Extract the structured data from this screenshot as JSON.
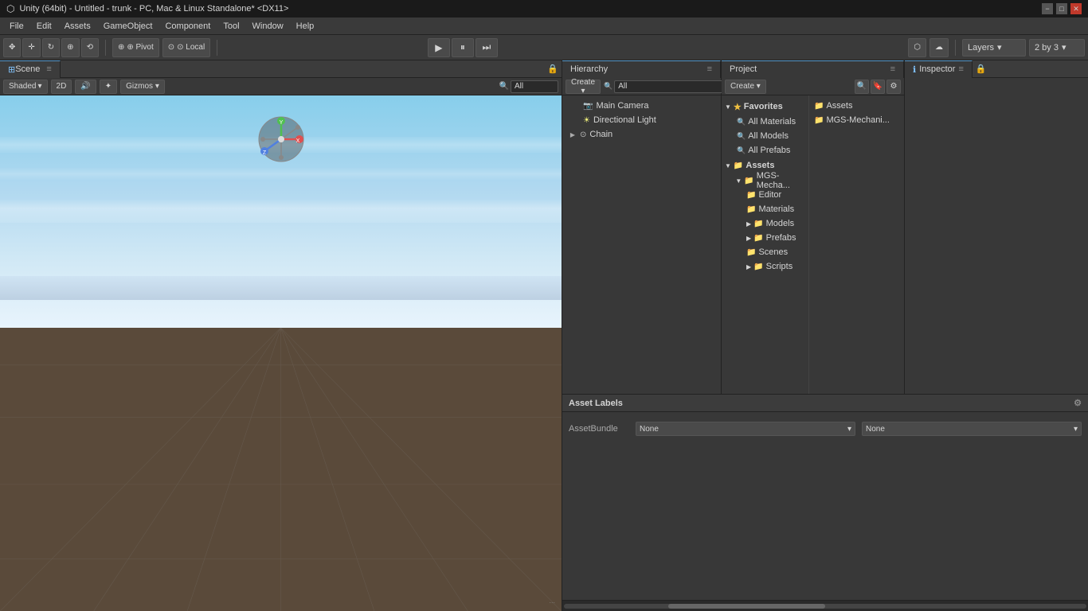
{
  "title_bar": {
    "title": "Unity (64bit) - Untitled - trunk - PC, Mac & Linux Standalone* <DX11>",
    "unity_icon": "unity-icon",
    "minimize_label": "−",
    "maximize_label": "□",
    "close_label": "✕"
  },
  "menu": {
    "items": [
      "File",
      "Edit",
      "Assets",
      "GameObject",
      "Component",
      "Tool",
      "Window",
      "Help"
    ]
  },
  "toolbar": {
    "transform_tools": [
      "✥",
      "✛",
      "↻",
      "⊕",
      "⟲"
    ],
    "pivot_label": "⊕ Pivot",
    "local_label": "⊙ Local",
    "play_label": "▶",
    "pause_label": "⏸",
    "step_label": "⏭",
    "layers_label": "Layers",
    "layout_label": "2 by 3",
    "undo_label": "↺",
    "redo_label": "↻",
    "collab_label": "⬡"
  },
  "scene": {
    "tab_label": "Scene",
    "toolbar": {
      "shaded_label": "Shaded",
      "toggle_2d_label": "2D",
      "audio_label": "🔊",
      "fx_label": "✦",
      "gizmos_label": "Gizmos ▾",
      "search_placeholder": "All"
    }
  },
  "hierarchy": {
    "tab_label": "Hierarchy",
    "create_label": "Create ▾",
    "search_placeholder": "All",
    "items": [
      {
        "name": "Main Camera",
        "icon": "camera",
        "indent": 0
      },
      {
        "name": "Directional Light",
        "icon": "light",
        "indent": 0
      },
      {
        "name": "Chain",
        "icon": "chain",
        "indent": 0,
        "arrow": "▶"
      }
    ]
  },
  "project": {
    "tab_label": "Project",
    "create_label": "Create ▾",
    "search_placeholder": "Search",
    "tree": [
      {
        "label": "Favorites",
        "icon": "star",
        "indent": 0,
        "arrow": "▼",
        "type": "section"
      },
      {
        "label": "All Materials",
        "icon": "search",
        "indent": 1
      },
      {
        "label": "All Models",
        "icon": "search",
        "indent": 1
      },
      {
        "label": "All Prefabs",
        "icon": "search",
        "indent": 1
      },
      {
        "label": "Assets",
        "icon": "folder",
        "indent": 0,
        "arrow": "▼",
        "type": "section"
      },
      {
        "label": "MGS-Mecha...",
        "icon": "folder",
        "indent": 1,
        "arrow": "▼"
      },
      {
        "label": "Editor",
        "icon": "folder",
        "indent": 2
      },
      {
        "label": "Materials",
        "icon": "folder",
        "indent": 2
      },
      {
        "label": "Models",
        "icon": "folder",
        "indent": 2,
        "arrow": "▶"
      },
      {
        "label": "Prefabs",
        "icon": "folder",
        "indent": 2,
        "arrow": "▶"
      },
      {
        "label": "Scenes",
        "icon": "folder",
        "indent": 2
      },
      {
        "label": "Scripts",
        "icon": "folder",
        "indent": 2,
        "arrow": "▶"
      }
    ],
    "assets_right": [
      {
        "label": "Assets",
        "icon": "folder"
      },
      {
        "label": "MGS-Mechani...",
        "icon": "folder"
      }
    ]
  },
  "inspector": {
    "tab_label": "Inspector",
    "icon": "info-icon"
  },
  "asset_labels": {
    "label": "Asset Labels",
    "asset_bundle_label": "AssetBundle",
    "asset_bundle_value": "None",
    "asset_bundle_variant": "None",
    "lock_icon": "🔒"
  }
}
